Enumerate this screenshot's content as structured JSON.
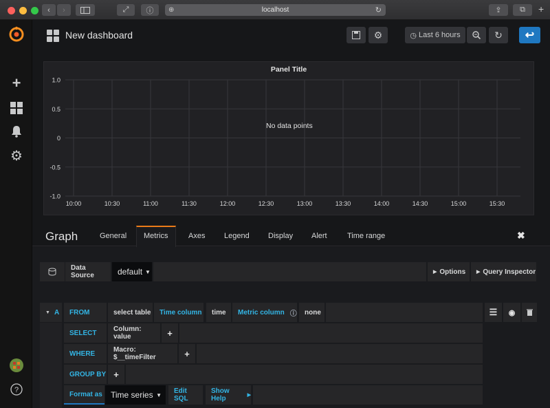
{
  "browser": {
    "url": "localhost"
  },
  "navbar": {
    "title": "New dashboard",
    "time_range": "Last 6 hours"
  },
  "panel": {
    "title": "Panel Title",
    "empty_message": "No data points"
  },
  "chart_data": {
    "type": "line",
    "title": "Panel Title",
    "x_ticks": [
      "10:00",
      "10:30",
      "11:00",
      "11:30",
      "12:00",
      "12:30",
      "13:00",
      "13:30",
      "14:00",
      "14:30",
      "15:00",
      "15:30"
    ],
    "y_ticks": [
      "1.0",
      "0.5",
      "0",
      "-0.5",
      "-1.0"
    ],
    "ylim": [
      -1.0,
      1.0
    ],
    "series": [],
    "grid": true
  },
  "editor": {
    "title": "Graph",
    "tabs": [
      "General",
      "Metrics",
      "Axes",
      "Legend",
      "Display",
      "Alert",
      "Time range"
    ],
    "active_tab": "Metrics",
    "datasource_label": "Data Source",
    "datasource_value": "default",
    "options_label": "Options",
    "query_inspector_label": "Query Inspector",
    "query": {
      "ref_id": "A",
      "from_label": "FROM",
      "table": "select table",
      "time_column_label": "Time column",
      "time_column": "time",
      "metric_column_label": "Metric column",
      "metric_column": "none",
      "select_label": "SELECT",
      "select_value": "Column: value",
      "where_label": "WHERE",
      "where_value": "Macro: $__timeFilter",
      "groupby_label": "GROUP BY",
      "format_label": "Format as",
      "format_value": "Time series",
      "edit_sql": "Edit SQL",
      "show_help": "Show Help"
    }
  }
}
